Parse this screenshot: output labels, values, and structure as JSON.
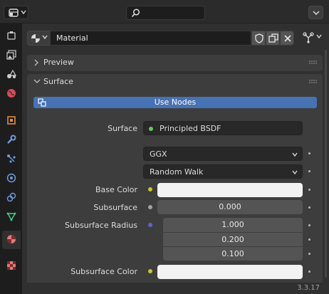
{
  "header": {
    "editor_type_icon": "properties-editor-icon",
    "search_icon": "search-icon",
    "options_icon": "chevron-down-icon"
  },
  "tabs": [
    {
      "name": "tool",
      "icon": "tool-icon"
    },
    {
      "name": "render",
      "icon": "camera-back-icon"
    },
    {
      "name": "output",
      "icon": "printer-icon"
    },
    {
      "name": "view-layer",
      "icon": "image-stack-icon"
    },
    {
      "name": "scene",
      "icon": "scene-shapes-icon"
    },
    {
      "name": "world",
      "icon": "world-icon"
    },
    {
      "name": "object",
      "icon": "object-cube-icon"
    },
    {
      "name": "modifiers",
      "icon": "wrench-icon"
    },
    {
      "name": "particles",
      "icon": "particles-icon"
    },
    {
      "name": "physics",
      "icon": "physics-orbit-icon"
    },
    {
      "name": "constraints",
      "icon": "constraint-icon"
    },
    {
      "name": "data",
      "icon": "mesh-data-icon"
    },
    {
      "name": "material",
      "icon": "material-sphere-icon",
      "active": true
    },
    {
      "name": "texture",
      "icon": "checker-texture-icon"
    }
  ],
  "material_header": {
    "name": "Material",
    "type_icon": "material-sphere-icon",
    "fake_user_icon": "shield-icon",
    "duplicate_icon": "duplicate-icon",
    "unlink_icon": "close-icon",
    "node_link_icon": "node-tree-icon"
  },
  "panels": {
    "preview": {
      "title": "Preview",
      "expanded": false
    },
    "surface": {
      "title": "Surface",
      "expanded": true
    }
  },
  "surface": {
    "use_nodes_label": "Use Nodes",
    "surface_label": "Surface",
    "surface_value": "Principled BSDF",
    "distribution": "GGX",
    "subsurface_method": "Random Walk",
    "base_color_label": "Base Color",
    "base_color": "#f2f2f2",
    "subsurface_label": "Subsurface",
    "subsurface_value": "0.000",
    "subsurface_radius_label": "Subsurface Radius",
    "subsurface_radius": [
      "1.000",
      "0.200",
      "0.100"
    ],
    "subsurface_color_label": "Subsurface Color",
    "subsurface_color": "#f2f2f2"
  },
  "colors": {
    "accent": "#4772b3",
    "socket_shader": "#63c763",
    "socket_color": "#c7c729",
    "socket_float": "#a1a1a1",
    "socket_vector": "#6363c7"
  },
  "version": "3.3.17"
}
